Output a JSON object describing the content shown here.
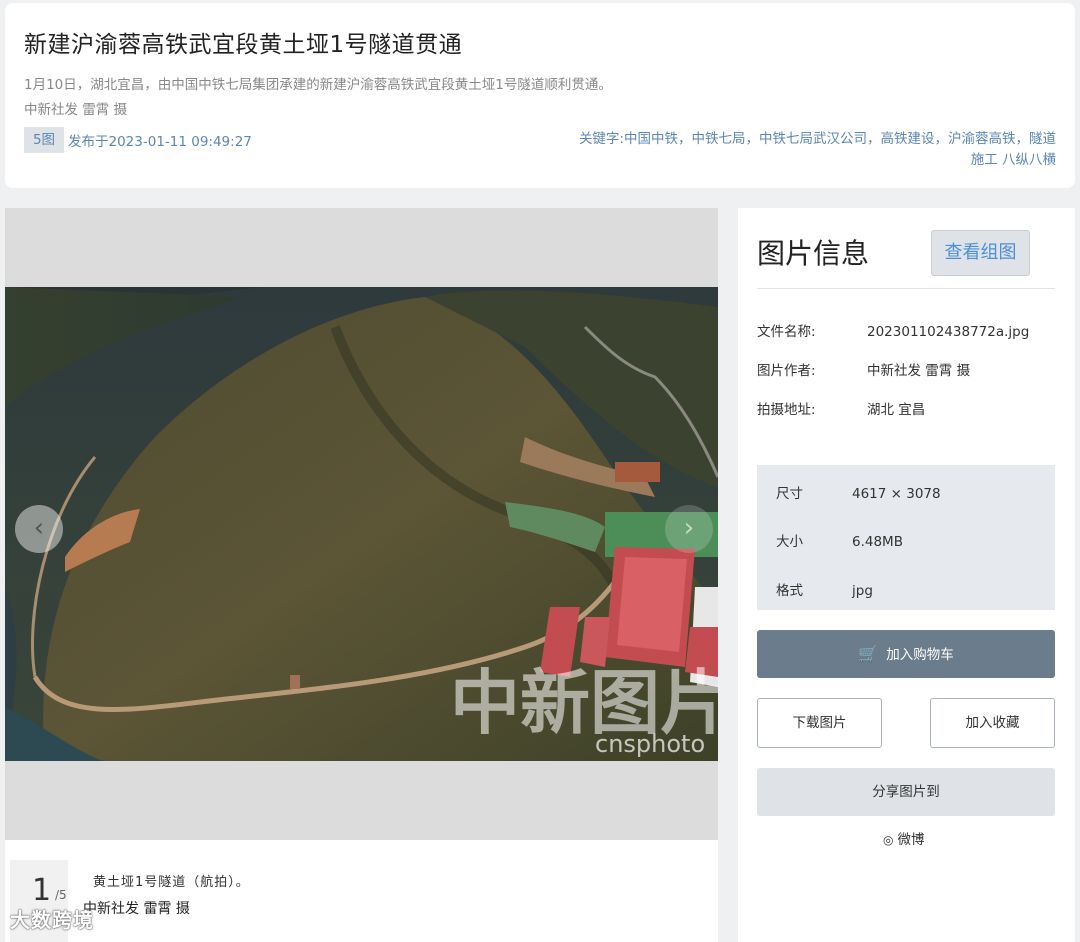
{
  "article": {
    "title": "新建沪渝蓉高铁武宜段黄土垭1号隧道贯通",
    "description": "1月10日，湖北宜昌，由中国中铁七局集团承建的新建沪渝蓉高铁武宜段黄土垭1号隧道顺利贯通。",
    "credit": "中新社发 雷霄 摄",
    "photo_count": "5图",
    "published": "发布于2023-01-11 09:49:27",
    "keywords_label": "关键字:",
    "keywords_line1": "中国中铁，中铁七局，中铁七局武汉公司，高铁建设，沪渝蓉高铁，隧道",
    "keywords_line2": "施工 八纵八横"
  },
  "viewer": {
    "prev_icon": "‹",
    "next_icon": "›",
    "watermark_cn": "中新图片",
    "watermark_en": "cnsphoto"
  },
  "caption": {
    "current": "1",
    "total": "/5",
    "text": "黄土垭1号隧道（航拍）。",
    "credit": "中新社发 雷霄 摄",
    "brand_mark": "大数跨境"
  },
  "info": {
    "title": "图片信息",
    "view_group": "查看组图",
    "filename_label": "文件名称:",
    "filename": "202301102438772a.jpg",
    "author_label": "图片作者:",
    "author": "中新社发 雷霄 摄",
    "location_label": "拍摄地址:",
    "location": "湖北 宜昌",
    "size_label": "尺寸",
    "size": "4617 × 3078",
    "filesize_label": "大小",
    "filesize": "6.48MB",
    "format_label": "格式",
    "format": "jpg",
    "cart": "加入购物车",
    "download": "下载图片",
    "favorite": "加入收藏",
    "share": "分享图片到",
    "weibo": "微博"
  },
  "colors": {
    "link": "#5b86b5",
    "cart_bg": "#6b7d8c",
    "accent_blue": "#4a90d9"
  }
}
